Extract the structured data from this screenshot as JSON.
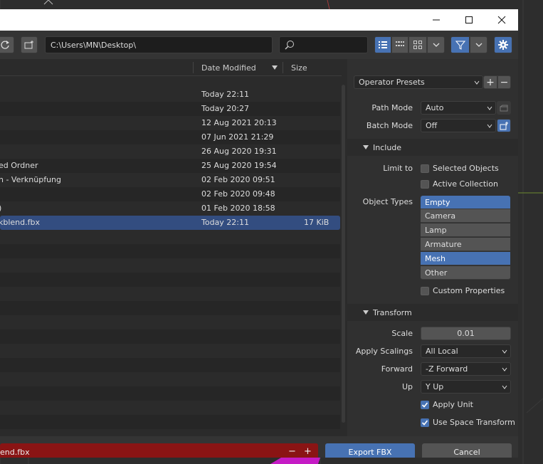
{
  "toolbar": {
    "path": "C:\\Users\\MN\\Desktop\\"
  },
  "file_list": {
    "columns": [
      "",
      "Date Modified",
      "Size"
    ],
    "rows": [
      {
        "name": "",
        "date": "Today 22:11",
        "size": ""
      },
      {
        "name": "",
        "date": "Today 20:27",
        "size": ""
      },
      {
        "name": "",
        "date": "12 Aug 2021 20:13",
        "size": ""
      },
      {
        "name": "",
        "date": "07 Jun 2021 21:29",
        "size": ""
      },
      {
        "name": "",
        "date": "26 Aug 2020 19:31",
        "size": ""
      },
      {
        "name": "ed Ordner",
        "date": "25 Aug 2020 19:54",
        "size": ""
      },
      {
        "name": "n - Verknüpfung",
        "date": "02 Feb 2020 09:51",
        "size": ""
      },
      {
        "name": "",
        "date": "02 Feb 2020 09:48",
        "size": ""
      },
      {
        "name": ")",
        "date": "01 Feb 2020 18:58",
        "size": ""
      },
      {
        "name": "kblend.fbx",
        "date": "Today 22:11",
        "size": "17 KiB"
      }
    ]
  },
  "sidebar": {
    "presets_label": "Operator Presets",
    "add_symbol": "+",
    "remove_symbol": "−",
    "path_mode": {
      "label": "Path Mode",
      "value": "Auto"
    },
    "batch_mode": {
      "label": "Batch Mode",
      "value": "Off"
    },
    "include": {
      "title": "Include",
      "limit_to_label": "Limit to",
      "selected_objects": "Selected Objects",
      "active_collection": "Active Collection",
      "object_types_label": "Object Types",
      "object_types": [
        "Empty",
        "Camera",
        "Lamp",
        "Armature",
        "Mesh",
        "Other"
      ],
      "object_types_selected": [
        "Empty",
        "Mesh"
      ],
      "custom_properties": "Custom Properties"
    },
    "transform": {
      "title": "Transform",
      "scale_label": "Scale",
      "scale_value": "0.01",
      "apply_scalings_label": "Apply Scalings",
      "apply_scalings_value": "All Local",
      "forward_label": "Forward",
      "forward_value": "-Z Forward",
      "up_label": "Up",
      "up_value": "Y Up",
      "apply_unit": "Apply Unit",
      "apply_unit_checked": true,
      "use_space_transform": "Use Space Transform",
      "use_space_transform_checked": true
    }
  },
  "footer": {
    "filename": "end.fbx",
    "decrement": "−",
    "increment": "+",
    "export_label": "Export FBX",
    "cancel_label": "Cancel"
  },
  "colors": {
    "accent": "#4772b3",
    "selected_row": "#334d80",
    "filename_warning": "#8a1414"
  }
}
